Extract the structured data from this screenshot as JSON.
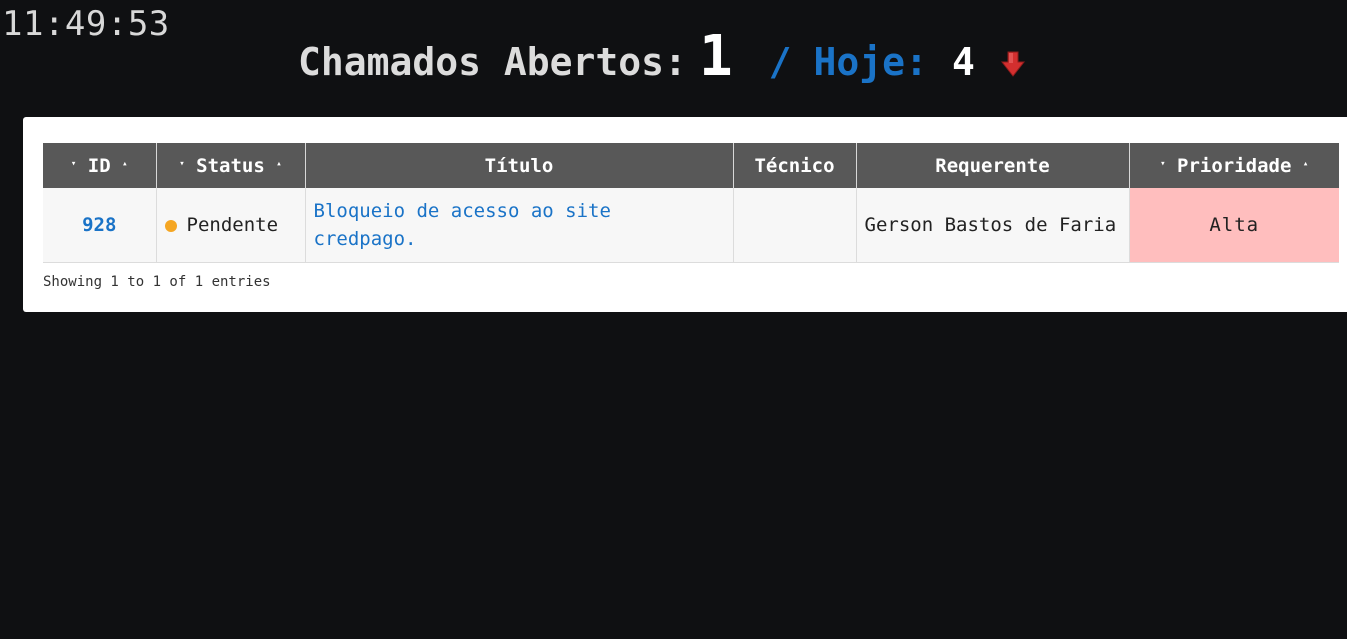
{
  "clock": "11:49:53",
  "header": {
    "open_label": "Chamados Abertos:",
    "open_count": "1",
    "separator": "/",
    "today_label": "Hoje:",
    "today_count": "4",
    "trend_icon": "arrow-down-icon",
    "trend_color": "#d32f2f"
  },
  "colors": {
    "background": "#0f1012",
    "accent": "#1a73c7",
    "header_bg": "#585858",
    "priority_high_bg": "#ffbebe",
    "status_pending": "#f5a623"
  },
  "table": {
    "columns": [
      {
        "label": "ID",
        "sortable": true
      },
      {
        "label": "Status",
        "sortable": true
      },
      {
        "label": "Título",
        "sortable": false
      },
      {
        "label": "Técnico",
        "sortable": false
      },
      {
        "label": "Requerente",
        "sortable": false
      },
      {
        "label": "Prioridade",
        "sortable": true
      }
    ],
    "sort_icons": {
      "desc": "▾",
      "asc": "▴"
    },
    "rows": [
      {
        "id": "928",
        "status": "Pendente",
        "status_icon": "orange-dot-icon",
        "title": "Bloqueio de acesso ao site credpago.",
        "technician": "",
        "requester": "Gerson Bastos de Faria",
        "priority": "Alta"
      }
    ],
    "info": "Showing 1 to 1 of 1 entries"
  }
}
